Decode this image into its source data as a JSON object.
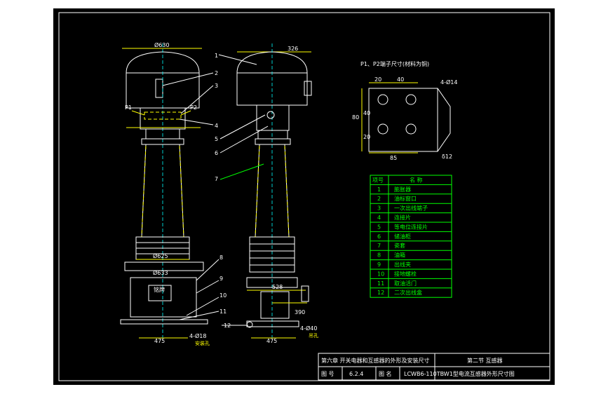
{
  "front_view": {
    "dims": {
      "top_dia": "Ø630",
      "flange1": "Ø625",
      "flange2": "Ø633",
      "base_width": "475",
      "holes": "4-Ø18"
    },
    "hole_caption": "安装孔",
    "terminal_p1": "P1",
    "terminal_p2": "P2",
    "nameplate": "铭牌",
    "callouts": [
      "2",
      "3",
      "4",
      "8",
      "9",
      "10",
      "11"
    ]
  },
  "side_view": {
    "dims": {
      "top_width": "326",
      "mid_width": "528",
      "base_width": "475",
      "offset": "390",
      "lift_holes": "4-Ø40"
    },
    "lift_caption": "吊孔",
    "callouts": [
      "1",
      "5",
      "6",
      "7",
      "12"
    ]
  },
  "terminal_detail": {
    "title": "P1、P2端子尺寸(材料为铜)",
    "dims": {
      "d1": "20",
      "d2": "40",
      "h1": "80",
      "h2": "40",
      "h3": "20",
      "width": "85",
      "holes": "4-Ø14",
      "thick": "δ12"
    }
  },
  "parts_table": {
    "headers": [
      "项号",
      "名  称"
    ],
    "rows": [
      [
        "1",
        "膨胀器"
      ],
      [
        "2",
        "油标窗口"
      ],
      [
        "3",
        "一次出线端子"
      ],
      [
        "4",
        "连接片"
      ],
      [
        "5",
        "等电位连接片"
      ],
      [
        "6",
        "储油柜"
      ],
      [
        "7",
        "瓷套"
      ],
      [
        "8",
        "油箱"
      ],
      [
        "9",
        "出线夹"
      ],
      [
        "10",
        "接地螺栓"
      ],
      [
        "11",
        "取油活门"
      ],
      [
        "12",
        "二次出线盒"
      ]
    ]
  },
  "title_block": {
    "chapter": "第六章 开关电器和互感器的外形及安装尺寸",
    "section": "第二节 互感器",
    "fig_label": "图 号",
    "fig_no": "6.2.4",
    "name_label": "图 名",
    "fig_name": "LCWB6-110TBW1型电流互感器外形尺寸图"
  }
}
